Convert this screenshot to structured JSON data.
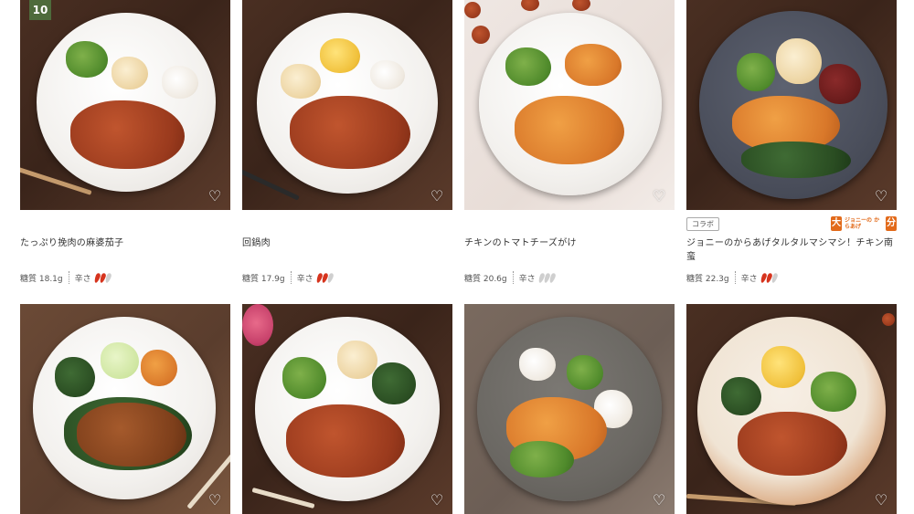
{
  "products": [
    {
      "name": "たっぷり挽肉の麻婆茄子",
      "sugar": "糖質 18.1g",
      "spicy_label": "辛さ",
      "spicy_level": 2,
      "rank": "10",
      "heart_icon": "heart-outline-icon"
    },
    {
      "name": "回鍋肉",
      "sugar": "糖質 17.9g",
      "spicy_label": "辛さ",
      "spicy_level": 2,
      "heart_icon": "heart-outline-icon"
    },
    {
      "name": "チキンのトマトチーズがけ",
      "sugar": "糖質 20.6g",
      "spicy_label": "辛さ",
      "spicy_level": 0,
      "heart_icon": "heart-outline-icon"
    },
    {
      "name": "ジョニーのからあげタルタルマシマシ！チキン南蛮",
      "sugar": "糖質 22.3g",
      "spicy_label": "辛さ",
      "spicy_level": 2,
      "collab_tag": "コラボ",
      "brand_logo": {
        "left": "大",
        "middle": "ジョニーの からあげ",
        "right": "分"
      },
      "heart_icon": "heart-outline-icon"
    },
    {
      "heart_icon": "heart-outline-icon"
    },
    {
      "heart_icon": "heart-outline-icon"
    },
    {
      "heart_icon": "heart-outline-icon"
    },
    {
      "heart_icon": "heart-outline-icon"
    }
  ],
  "colors": {
    "chili_on": "#d6341e",
    "chili_off": "#cfcfcf",
    "rank_badge": "#4e6b3c",
    "brand": "#e26a1a"
  }
}
